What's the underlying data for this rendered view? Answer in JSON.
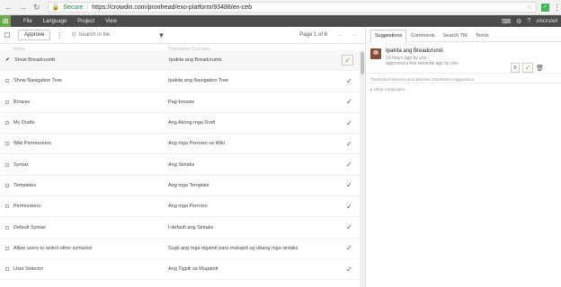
{
  "browser": {
    "secure_label": "Secure",
    "url": "https://crowdin.com/proofread/exo-platform/93488/en-ceb"
  },
  "appbar": {
    "menu": [
      "File",
      "Language",
      "Project",
      "View"
    ],
    "user": "vincrutell"
  },
  "toolbar": {
    "approve_label": "Approve",
    "search_placeholder": "Search in file",
    "page": "Page 1 of 6"
  },
  "columns": {
    "source": "String",
    "translation": "Translation Concepts"
  },
  "rows": [
    {
      "source": "Show Breadcrumb",
      "translation": "Ipakita ang Breadcrumb"
    },
    {
      "source": "Show Navigation Tree",
      "translation": "Ipakita ang Navigation Tree"
    },
    {
      "source": "Browse",
      "translation": "Pag-browse"
    },
    {
      "source": "My Drafts",
      "translation": "Ang Akong mga Draft"
    },
    {
      "source": "Wiki Permissions",
      "translation": "Ang mga Permiso sa Wiki"
    },
    {
      "source": "Syntax",
      "translation": "Ang Sintaks"
    },
    {
      "source": "Templates",
      "translation": "Ang mga Template"
    },
    {
      "source": "Permissions",
      "translation": "Ang mga Permiso"
    },
    {
      "source": "Default Syntax",
      "translation": "I-default ang Sintaks"
    },
    {
      "source": "Allow users to select other syntaxes",
      "translation": "Sugti ang mga nigamit para makapili ug ubang mga sintaks"
    },
    {
      "source": "User Selector",
      "translation": "Ang Tigpili sa Mugamit"
    }
  ],
  "panel": {
    "tabs": [
      "Suggestions",
      "Comments",
      "Search TM",
      "Terms"
    ],
    "suggestion": {
      "text": "Ipakita ang Breadcrumb",
      "meta1": "19 hours ago by you",
      "meta2": "approved a few seconds ago by you",
      "votes": "0"
    },
    "tm_label": "Translation Memory and Machine Translation suggestions",
    "other_label": "Other Languages"
  }
}
